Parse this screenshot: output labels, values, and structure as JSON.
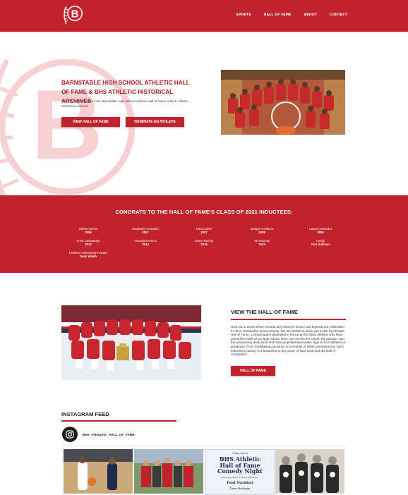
{
  "header": {
    "logo_letter": "B",
    "nav": [
      "SPORTS",
      "HALL OF FAME",
      "ABOUT",
      "CONTACT"
    ]
  },
  "hero": {
    "title": "BARNSTABLE HIGH SCHOOL ATHLETIC HALL OF FAME & BHS ATHLETIC HISTORICAL ARCHIVES",
    "subtitle": "The Official Web Site of the Barnstable High School Athletic Hall of Fame & BHS Athletic Historical Archives.",
    "btn_view": "VIEW HALL OF FAME",
    "btn_nominate": "NOMINATE AN ATHLETE",
    "bg_letter": "B"
  },
  "inductees": {
    "title": "CONGRATS TO THE HALL OF FAME'S CLASS OF 2021 INDUCTEES:",
    "list": [
      {
        "name": "Stefan Genes",
        "year": "2006"
      },
      {
        "name": "Stephanie Scarpelo",
        "year": "2007"
      },
      {
        "name": "Kara Cullen",
        "year": "2007"
      },
      {
        "name": "Morgan Kendrew",
        "year": "2008"
      },
      {
        "name": "Casey Ochander",
        "year": "2008"
      },
      {
        "name": "Anne Cavanaugh",
        "year": "2010"
      },
      {
        "name": "Amanda Henson",
        "year": "2014"
      },
      {
        "name": "Owen Murray",
        "year": "2015"
      },
      {
        "name": "Tal Twomey",
        "year": "2016"
      },
      {
        "name": "Coach",
        "year": "Kim Sullivan"
      },
      {
        "name": "Lifetime Achievement Award",
        "year": "Sean Walsh"
      }
    ]
  },
  "hof": {
    "title": "VIEW THE HALL OF FAME",
    "text": "Step into a world where records are etched in history and legends are celebrated for their remarkable achievements. We are thrilled to invite you to the Red Raider Hall of Fame, a virtual space dedicated to honoring the finest athletes who have graced the halls of our high school. Here, we cherish the sweat, the passion, and the unwavering dedication that have propelled Barnstable High School athletes to greatness. From breathtaking victories to moments of sheer perseverance, each inductee's journey is a testament to the power of hard work and the thrill of competition.",
    "button": "HALL OF FAME"
  },
  "instagram": {
    "title": "INSTAGRAM FEED",
    "handle": "BHS_ATHLETIC_HALL_OF_FAME",
    "poster": {
      "date": "Friday, June 9",
      "lines": [
        "BHS Athletic",
        "Hall of Fame",
        "Comedy Night"
      ],
      "small": "Doors open at 6 p.m. Show starts 8 p.m.",
      "host": "Paul Nardizzi",
      "host2": "Dave Rattigan"
    }
  },
  "colors": {
    "brand_red": "#c1222b",
    "white": "#ffffff",
    "text_dark": "#222222"
  },
  "icons": [
    "instagram-icon"
  ]
}
